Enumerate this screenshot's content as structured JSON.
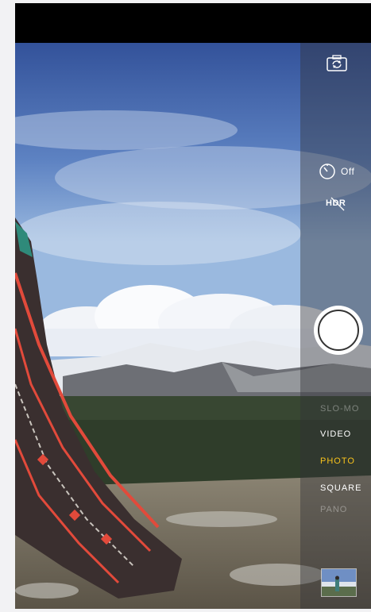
{
  "controls": {
    "timer_state": "Off",
    "hdr_label": "HDR"
  },
  "modes": [
    {
      "label": "SLO-MO",
      "state": "dim"
    },
    {
      "label": "VIDEO",
      "state": "normal"
    },
    {
      "label": "PHOTO",
      "state": "active"
    },
    {
      "label": "SQUARE",
      "state": "normal"
    },
    {
      "label": "PANO",
      "state": "dim"
    }
  ],
  "colors": {
    "active_mode": "#f7c21c",
    "sidebar": "#323237",
    "sky_top": "#3b5fa6",
    "sky_bottom": "#8fb2dc"
  },
  "icons": {
    "camera_switch": "camera-flip-icon",
    "timer": "timer-icon",
    "hdr": "hdr-off-icon"
  }
}
